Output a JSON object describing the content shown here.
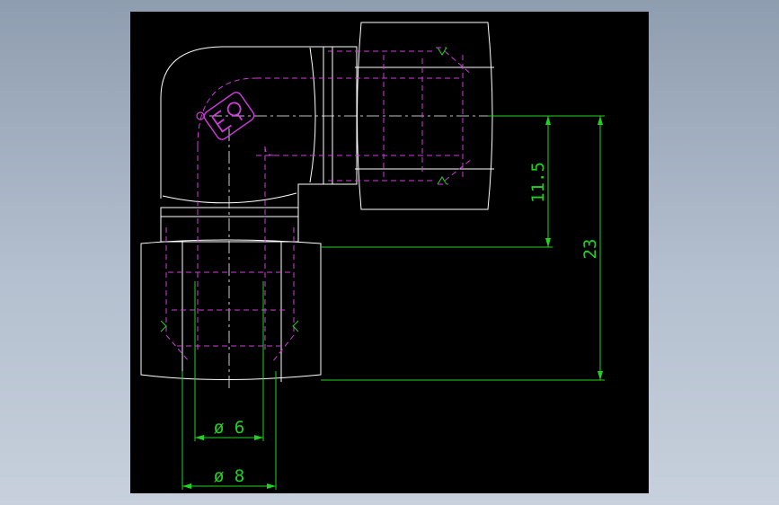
{
  "colors": {
    "background": "#000000",
    "outline": "#ffffff",
    "hidden_lines": "#d23be0",
    "dimensions": "#1fd41f"
  },
  "dimensions": {
    "height_small": "11.5",
    "height_total": "23",
    "inner_diameter": "ø 6",
    "outer_diameter": "ø 8"
  }
}
